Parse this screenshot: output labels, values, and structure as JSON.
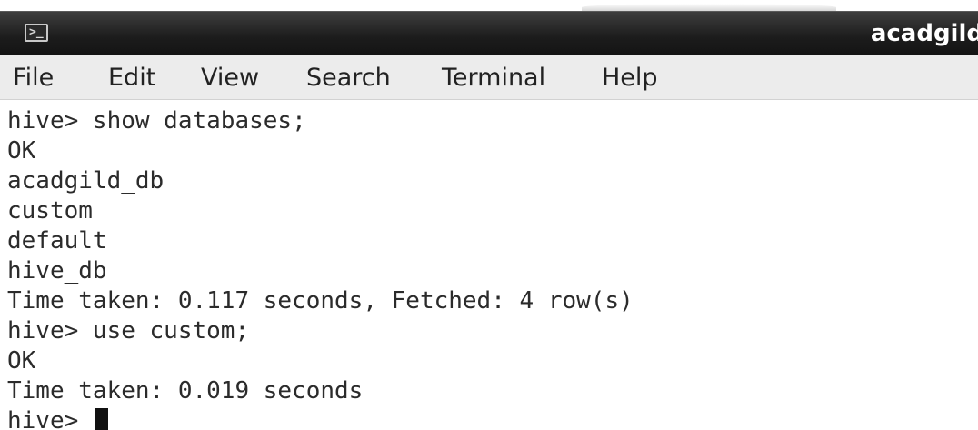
{
  "window": {
    "title": "acadgild"
  },
  "icons": {
    "terminal": "terminal-icon"
  },
  "menubar": {
    "items": [
      {
        "label": "File"
      },
      {
        "label": "Edit"
      },
      {
        "label": "View"
      },
      {
        "label": "Search"
      },
      {
        "label": "Terminal"
      },
      {
        "label": "Help"
      }
    ]
  },
  "terminal": {
    "lines": [
      "hive> show databases;",
      "OK",
      "acadgild_db",
      "custom",
      "default",
      "hive_db",
      "Time taken: 0.117 seconds, Fetched: 4 row(s)",
      "hive> use custom;",
      "OK",
      "Time taken: 0.019 seconds",
      "hive> "
    ]
  },
  "colors": {
    "titlebar": "#1c1c1c",
    "menubar": "#ececec",
    "terminal_bg": "#ffffff",
    "terminal_fg": "#2b2b2b"
  }
}
